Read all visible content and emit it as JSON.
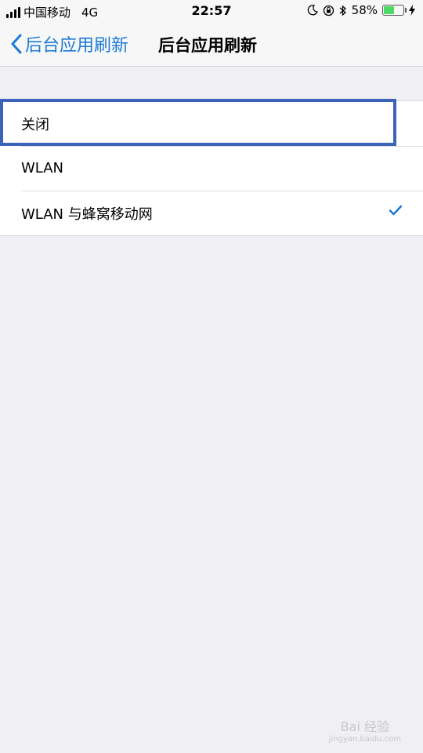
{
  "status_bar": {
    "carrier": "中国移动",
    "network": "4G",
    "time": "22:57",
    "battery_percent": "58%",
    "battery_level": 0.58
  },
  "nav": {
    "back_label": "后台应用刷新",
    "title": "后台应用刷新"
  },
  "options": [
    {
      "label": "关闭",
      "selected": false,
      "highlighted": true
    },
    {
      "label": "WLAN",
      "selected": false
    },
    {
      "label": "WLAN 与蜂窝移动网",
      "selected": true
    }
  ],
  "watermark": {
    "text": "Bai 经验",
    "sub": "jingyan.baidu.com"
  },
  "colors": {
    "accent": "#1a7ad3",
    "highlight": "#3c63b8",
    "background": "#efeff4",
    "battery": "#4cd964"
  }
}
